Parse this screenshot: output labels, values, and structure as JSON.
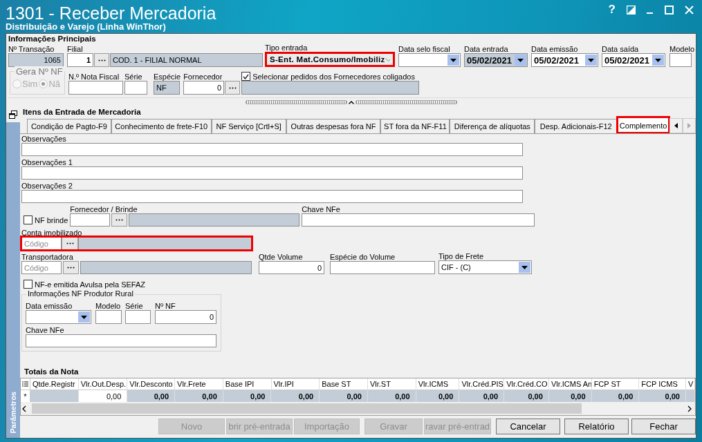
{
  "window": {
    "title": "1301 - Receber Mercadoria",
    "subtitle": "Distribuição e Varejo (Linha WinThor)",
    "help": "?"
  },
  "main": {
    "title": "Informações Principais",
    "transacao": {
      "label": "Nº Transação",
      "value": "1065"
    },
    "filial": {
      "label": "Filial",
      "value": "1",
      "name": "COD. 1 - FILIAL NORMAL"
    },
    "tipo_entrada": {
      "label": "Tipo entrada",
      "value": "S-Ent. Mat.Consumo/Imobiliz",
      "highlighted": true
    },
    "dates": [
      {
        "label": "Data selo fiscal",
        "disabled": false
      },
      {
        "label": "Data entrada",
        "value": "05/02/2021",
        "disabled": true
      },
      {
        "label": "Data emissão",
        "value": "05/02/2021",
        "disabled": false
      },
      {
        "label": "Data saída",
        "value": "05/02/2021",
        "disabled": false
      }
    ],
    "modelo": {
      "label": "Modelo"
    },
    "gera_nf": {
      "label": "Gera Nº NF",
      "options": [
        {
          "label": "Sim",
          "selected": false
        },
        {
          "label": "Nã",
          "selected": true
        }
      ]
    },
    "nota_fiscal": {
      "label": "N.º Nota Fiscal"
    },
    "serie": {
      "label": "Série"
    },
    "especie": {
      "label": "Espécie",
      "value": "NF"
    },
    "fornecedor": {
      "label": "Fornecedor",
      "value": "0"
    },
    "coligados": {
      "label": "Selecionar pedidos dos Fornecedores coligados",
      "checked": true
    }
  },
  "items": {
    "title": "Itens da Entrada de Mercadoria",
    "side_tab": "Parâmetros",
    "tabs": [
      {
        "label": "Condição de Pagto-F9",
        "selected": false,
        "highlighted": false
      },
      {
        "label": "Conhecimento de frete-F10",
        "selected": false,
        "highlighted": false
      },
      {
        "label": "NF Serviço [Crtl+S]",
        "selected": false,
        "highlighted": false
      },
      {
        "label": "Outras despesas fora NF",
        "selected": false,
        "highlighted": false
      },
      {
        "label": "ST fora da NF-F11",
        "selected": false,
        "highlighted": false
      },
      {
        "label": "Diferença de alíquotas",
        "selected": false,
        "highlighted": false
      },
      {
        "label": "Desp. Adicionais-F12",
        "selected": false,
        "highlighted": false
      },
      {
        "label": "Complemento",
        "selected": true,
        "highlighted": true
      }
    ]
  },
  "complemento": {
    "observacoes": [
      "Observações",
      "Observações 1",
      "Observações 2"
    ],
    "nf_brinde": {
      "label": "NF brinde",
      "checked": false
    },
    "fornecedor_brinde": {
      "label": "Fornecedor / Brinde"
    },
    "chave_nfe": {
      "label": "Chave NFe"
    },
    "conta_imobilizado": {
      "label": "Conta imobilizado",
      "placeholder": "Código",
      "highlighted": true
    },
    "transportadora": {
      "label": "Transportadora",
      "placeholder": "Código"
    },
    "qtde_volume": {
      "label": "Qtde Volume",
      "value": "0"
    },
    "especie_volume": {
      "label": "Espécie do Volume"
    },
    "tipo_frete": {
      "label": "Tipo de Frete",
      "value": "CIF - (C)"
    },
    "avulsa": {
      "label": "NF-e emitida Avulsa pela SEFAZ",
      "checked": false
    },
    "produtor_rural": {
      "title": "Informações NF Produtor Rural",
      "data_emissao": "Data emissão",
      "modelo": "Modelo",
      "serie": "Série",
      "nf": {
        "label": "Nº NF",
        "value": "0"
      },
      "chave": "Chave NFe"
    }
  },
  "totals": {
    "title": "Totais da Nota",
    "row_marker": "*",
    "columns": [
      {
        "label": "Qtde.Registr",
        "editable": false
      },
      {
        "label": "Vlr.Out.Desp.",
        "value": "0,00",
        "editable": true
      },
      {
        "label": "Vlr.Desconto",
        "value": "0,00",
        "editable": false
      },
      {
        "label": "Vlr.Frete",
        "value": "0,00",
        "editable": false
      },
      {
        "label": "Base IPI",
        "value": "0,00",
        "editable": false
      },
      {
        "label": "Vlr.IPI",
        "value": "0,00",
        "editable": false
      },
      {
        "label": "Base ST",
        "value": "0,00",
        "editable": false
      },
      {
        "label": "Vlr.ST",
        "value": "0,00",
        "editable": false
      },
      {
        "label": "Vlr.ICMS",
        "value": "0,00",
        "editable": false
      },
      {
        "label": "Vlr.Créd.PIS",
        "value": "0,00",
        "editable": false
      },
      {
        "label": "Vlr.Créd.CO",
        "value": "0,00",
        "editable": false
      },
      {
        "label": "Vlr.ICMS An",
        "value": "0,00",
        "editable": false
      },
      {
        "label": "FCP ST",
        "value": "0,00",
        "editable": false
      },
      {
        "label": "FCP ICMS",
        "value": "0,00",
        "editable": false
      },
      {
        "label": "V",
        "editable": false
      }
    ]
  },
  "buttons": [
    {
      "label": "Novo",
      "disabled": true
    },
    {
      "label": "brir pré-entrada",
      "disabled": true
    },
    {
      "label": "Importação",
      "disabled": true
    },
    {
      "label": "Gravar",
      "disabled": true
    },
    {
      "label": "ravar pré-entrad",
      "disabled": true
    },
    {
      "label": "Cancelar",
      "disabled": false
    },
    {
      "label": "Relatório",
      "disabled": false
    },
    {
      "label": "Fechar",
      "disabled": false
    }
  ]
}
